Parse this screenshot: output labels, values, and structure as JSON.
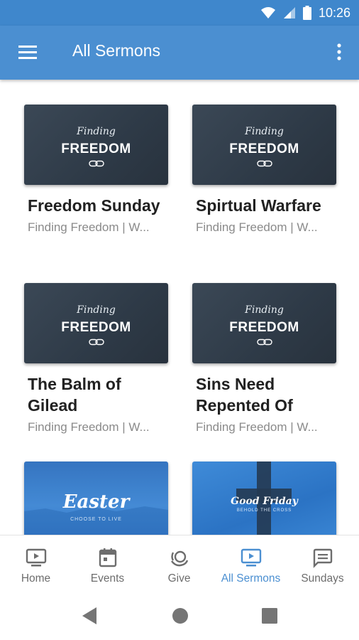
{
  "status": {
    "time": "10:26"
  },
  "appbar": {
    "title": "All Sermons"
  },
  "thumbnail_text": {
    "finding": "Finding",
    "freedom": "FREEDOM",
    "easter": "Easter",
    "easter_sub": "CHOOSE TO LIVE",
    "good_friday": "Good Friday",
    "good_friday_sub": "BEHOLD THE CROSS"
  },
  "sermons": [
    {
      "title": "Freedom Sunday",
      "subtitle": "Finding Freedom | W..."
    },
    {
      "title": "Spirtual Warfare",
      "subtitle": "Finding Freedom | W..."
    },
    {
      "title": "The Balm of Gilead",
      "subtitle": "Finding Freedom | W..."
    },
    {
      "title": "Sins Need Repented Of",
      "subtitle": "Finding Freedom | W..."
    }
  ],
  "bottom_nav": [
    {
      "label": "Home",
      "icon": "tv-play-icon"
    },
    {
      "label": "Events",
      "icon": "calendar-icon"
    },
    {
      "label": "Give",
      "icon": "give-icon"
    },
    {
      "label": "All Sermons",
      "icon": "tv-play-icon",
      "active": true
    },
    {
      "label": "Sundays",
      "icon": "message-icon"
    }
  ],
  "colors": {
    "primary": "#4b8fd1",
    "status_bar": "#3f87cc",
    "inactive": "#6d6d6d"
  }
}
